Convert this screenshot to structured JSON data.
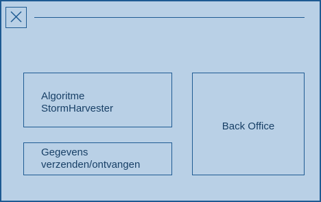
{
  "colors": {
    "background": "#b9d0e6",
    "stroke": "#1e5a92",
    "block_background": "#b9d0e6",
    "text": "#173f66"
  },
  "window": {
    "close_icon": "close-icon"
  },
  "blocks": [
    {
      "id": "algoritme",
      "lines": [
        "Algoritme",
        "StormHarvester"
      ]
    },
    {
      "id": "gegevens",
      "lines": [
        "Gegevens",
        "verzenden/ontvangen"
      ]
    },
    {
      "id": "backoffice",
      "lines": [
        "Back Office"
      ]
    }
  ]
}
